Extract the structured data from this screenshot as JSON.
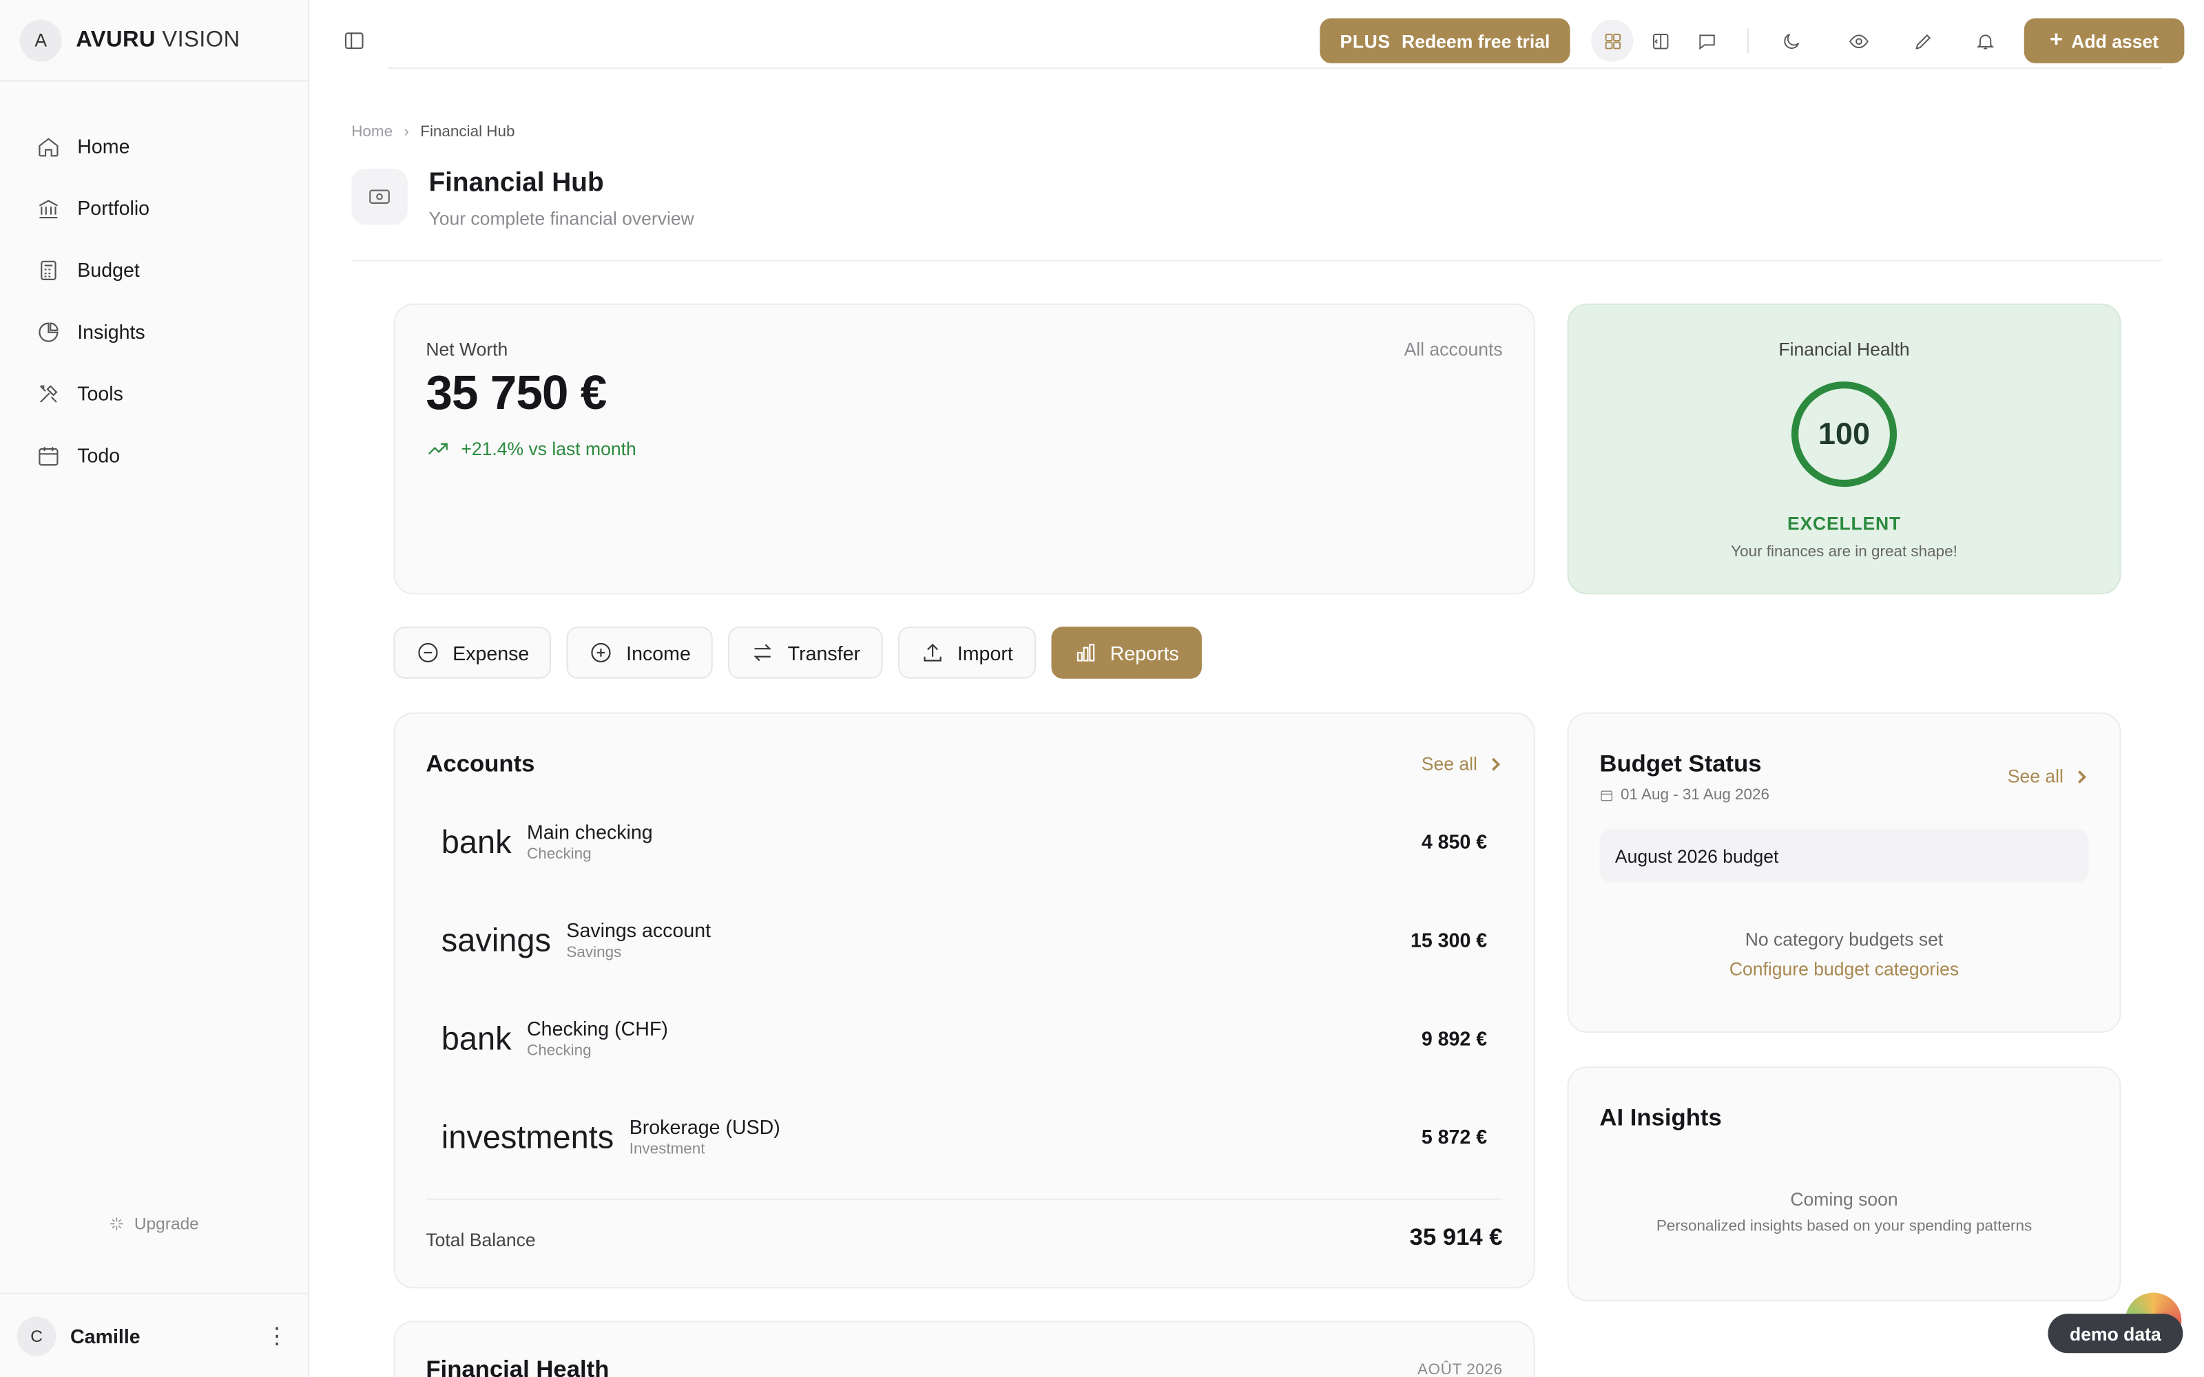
{
  "brand": {
    "initial": "A",
    "name_bold": "AVURU",
    "name_light": "VISION"
  },
  "sidebar": {
    "items": [
      {
        "label": "Home",
        "icon": "home-icon"
      },
      {
        "label": "Portfolio",
        "icon": "bank-icon"
      },
      {
        "label": "Budget",
        "icon": "calculator-icon"
      },
      {
        "label": "Insights",
        "icon": "pie-chart-icon"
      },
      {
        "label": "Tools",
        "icon": "tools-icon"
      },
      {
        "label": "Todo",
        "icon": "calendar-icon"
      }
    ],
    "upgrade_label": "Upgrade",
    "user": {
      "initial": "C",
      "name": "Camille"
    }
  },
  "topbar": {
    "plus_tag": "PLUS",
    "plus_label": "Redeem free trial",
    "add_asset_label": "Add asset",
    "accent_color": "#a88951"
  },
  "breadcrumb": {
    "home": "Home",
    "current": "Financial Hub"
  },
  "page": {
    "title": "Financial Hub",
    "subtitle": "Your complete financial overview"
  },
  "net_worth": {
    "label": "Net Worth",
    "scope": "All accounts",
    "value": "35 750 €",
    "trend": "+21.4% vs last month"
  },
  "financial_health": {
    "title": "Financial Health",
    "score": "100",
    "score_fraction": 1.0,
    "level": "EXCELLENT",
    "description": "Your finances are in great shape!",
    "color": "#2b8a3e"
  },
  "actions": [
    {
      "label": "Expense",
      "icon": "minus-circle-icon"
    },
    {
      "label": "Income",
      "icon": "plus-circle-icon"
    },
    {
      "label": "Transfer",
      "icon": "transfer-icon"
    },
    {
      "label": "Import",
      "icon": "upload-icon"
    },
    {
      "label": "Reports",
      "icon": "bar-chart-icon"
    }
  ],
  "accounts": {
    "title": "Accounts",
    "see_all": "See all",
    "rows": [
      {
        "icon": "bank",
        "name": "Main checking",
        "type": "Checking",
        "amount": "4 850 €"
      },
      {
        "icon": "savings",
        "name": "Savings account",
        "type": "Savings",
        "amount": "15 300 €"
      },
      {
        "icon": "bank",
        "name": "Checking (CHF)",
        "type": "Checking",
        "amount": "9 892 €"
      },
      {
        "icon": "investments",
        "name": "Brokerage (USD)",
        "type": "Investment",
        "amount": "5 872 €"
      }
    ],
    "total_label": "Total Balance",
    "total_value": "35 914 €"
  },
  "budget": {
    "title": "Budget Status",
    "see_all": "See all",
    "range": "01 Aug - 31 Aug 2026",
    "budget_name": "August 2026 budget",
    "empty": "No category budgets set",
    "configure": "Configure budget categories"
  },
  "ai": {
    "title": "AI Insights",
    "status": "Coming soon",
    "description": "Personalized insights based on your spending patterns"
  },
  "fh_section": {
    "title": "Financial Health",
    "month": "AOÛT 2026"
  },
  "demo_label": "demo data"
}
